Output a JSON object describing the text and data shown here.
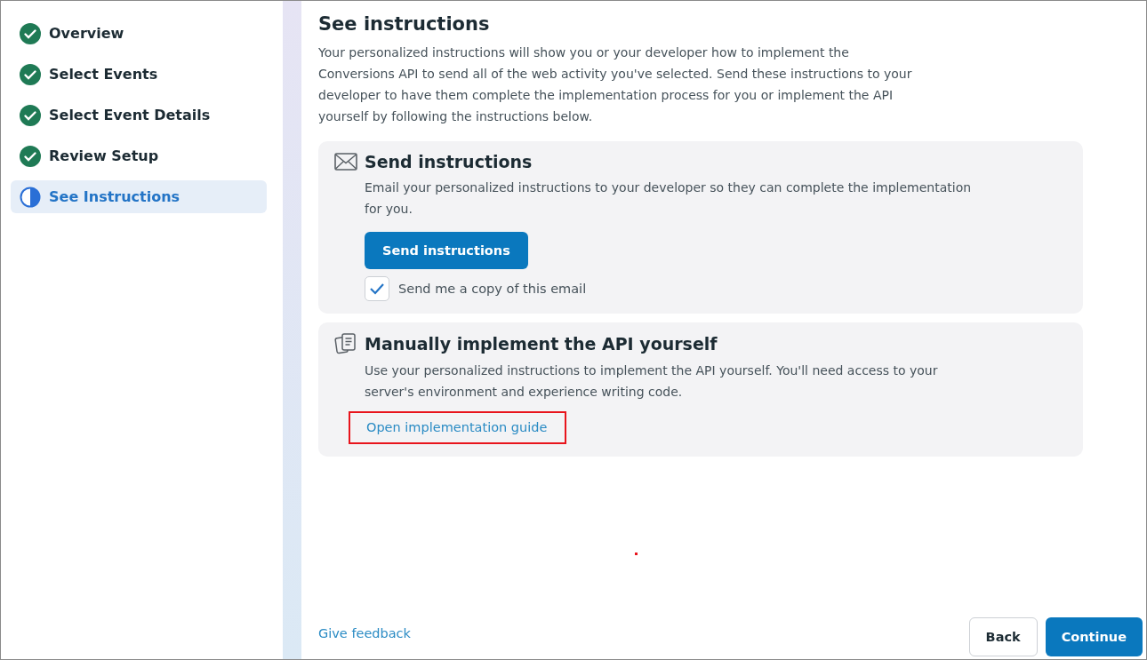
{
  "steps": [
    {
      "label": "Overview",
      "completed": true,
      "selected": false
    },
    {
      "label": "Select Events",
      "completed": true,
      "selected": false
    },
    {
      "label": "Select Event Details",
      "completed": true,
      "selected": false
    },
    {
      "label": "Review Setup",
      "completed": true,
      "selected": false
    },
    {
      "label": "See Instructions",
      "completed": false,
      "selected": true
    }
  ],
  "heading": "See instructions",
  "intro": "Your personalized instructions will show you or your developer how to implement the Conversions API to send all of the web activity you've selected. Send these instructions to your developer to have them complete the implementation process for you or implement the API yourself by following the instructions below.",
  "cards": [
    {
      "kind": "email",
      "title": "Send instructions",
      "text": "Email your personalized instructions to your developer so they can complete the implementation for you.",
      "button": "Send instructions",
      "checkbox": {
        "label": "Send me a copy of this email",
        "checked": true
      }
    },
    {
      "kind": "manual",
      "title": "Manually implement the API yourself",
      "text": "Use your personalized instructions to implement the API yourself. You'll need access to your server's environment and experience writing code.",
      "link": "Open implementation guide",
      "highlighted": true
    }
  ],
  "feedback": "Give feedback",
  "buttons": [
    {
      "label": "Back",
      "kind": "secondary"
    },
    {
      "label": "Continue",
      "kind": "primary"
    }
  ]
}
